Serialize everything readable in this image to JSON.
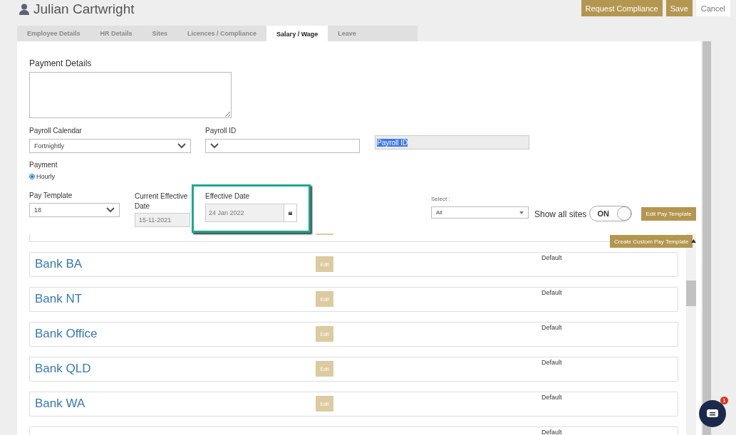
{
  "header": {
    "title": "Julian Cartwright",
    "buttons": [
      {
        "label": "Request Compliance",
        "kind": "primary"
      },
      {
        "label": "Save",
        "kind": "primary"
      },
      {
        "label": "Cancel",
        "kind": "plain"
      }
    ]
  },
  "tabs": [
    {
      "label": "Employee Details",
      "selected": false
    },
    {
      "label": "HR Details",
      "selected": false
    },
    {
      "label": "Sites",
      "selected": false
    },
    {
      "label": "Licences / Compliance",
      "selected": false
    },
    {
      "label": "Salary / Wage",
      "selected": true
    },
    {
      "label": "Leave",
      "selected": false
    }
  ],
  "payment_details": {
    "label": "Payment Details"
  },
  "payroll_calendar": {
    "label": "Payroll Calendar",
    "value": "Fortnightly"
  },
  "payroll_id": {
    "label": "Payroll ID",
    "readonly_value": "Payroll ID"
  },
  "payment": {
    "label": "Payment",
    "options": [
      {
        "label": "Hourly",
        "selected": true
      }
    ]
  },
  "pay_template": {
    "label": "Pay Template",
    "value": "18"
  },
  "current_effective_date": {
    "label": "Current Effective Date",
    "value": "15-11-2021"
  },
  "effective_date": {
    "label": "Effective Date",
    "value": "24 Jan 2022"
  },
  "site_select": {
    "label": "Select :",
    "value": "All"
  },
  "show_all_sites": {
    "label": "Show all sites",
    "toggle_text": "ON",
    "on": true
  },
  "edit_pay_template": "Edit Pay Template",
  "create_custom_pay_template": "Create Custom Pay Template",
  "templates": [
    {
      "name": "Bank BA",
      "action": "Edit",
      "status": "Default"
    },
    {
      "name": "Bank NT",
      "action": "Edit",
      "status": "Default"
    },
    {
      "name": "Bank Office",
      "action": "Edit",
      "status": "Default"
    },
    {
      "name": "Bank QLD",
      "action": "Edit",
      "status": "Default"
    },
    {
      "name": "Bank WA",
      "action": "Edit",
      "status": "Default"
    },
    {
      "status": "Default"
    }
  ],
  "chat": {
    "badge": "1"
  }
}
